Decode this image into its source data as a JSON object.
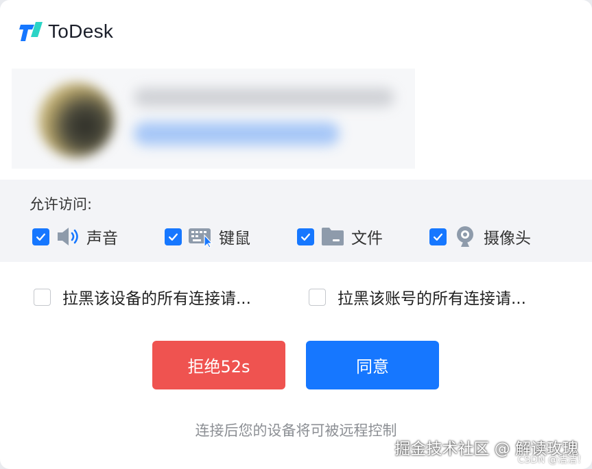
{
  "app": {
    "name": "ToDesk"
  },
  "permissions": {
    "title": "允许访问:",
    "items": [
      {
        "label": "声音",
        "icon": "speaker-icon",
        "checked": true
      },
      {
        "label": "键鼠",
        "icon": "keyboard-mouse-icon",
        "checked": true
      },
      {
        "label": "文件",
        "icon": "folder-icon",
        "checked": true
      },
      {
        "label": "摄像头",
        "icon": "webcam-icon",
        "checked": true
      }
    ]
  },
  "block_options": [
    {
      "label": "拉黑该设备的所有连接请...",
      "checked": false
    },
    {
      "label": "拉黑该账号的所有连接请...",
      "checked": false
    }
  ],
  "buttons": {
    "reject": "拒绝52s",
    "accept": "同意"
  },
  "hint": "连接后您的设备将可被远程控制",
  "watermark": {
    "main": "掘金技术社区 @ 解读玫瑰",
    "sub": "CSDN @洁洁！"
  },
  "colors": {
    "accent": "#1677ff",
    "danger": "#ef5350",
    "icon_gray": "#8e9bab"
  }
}
